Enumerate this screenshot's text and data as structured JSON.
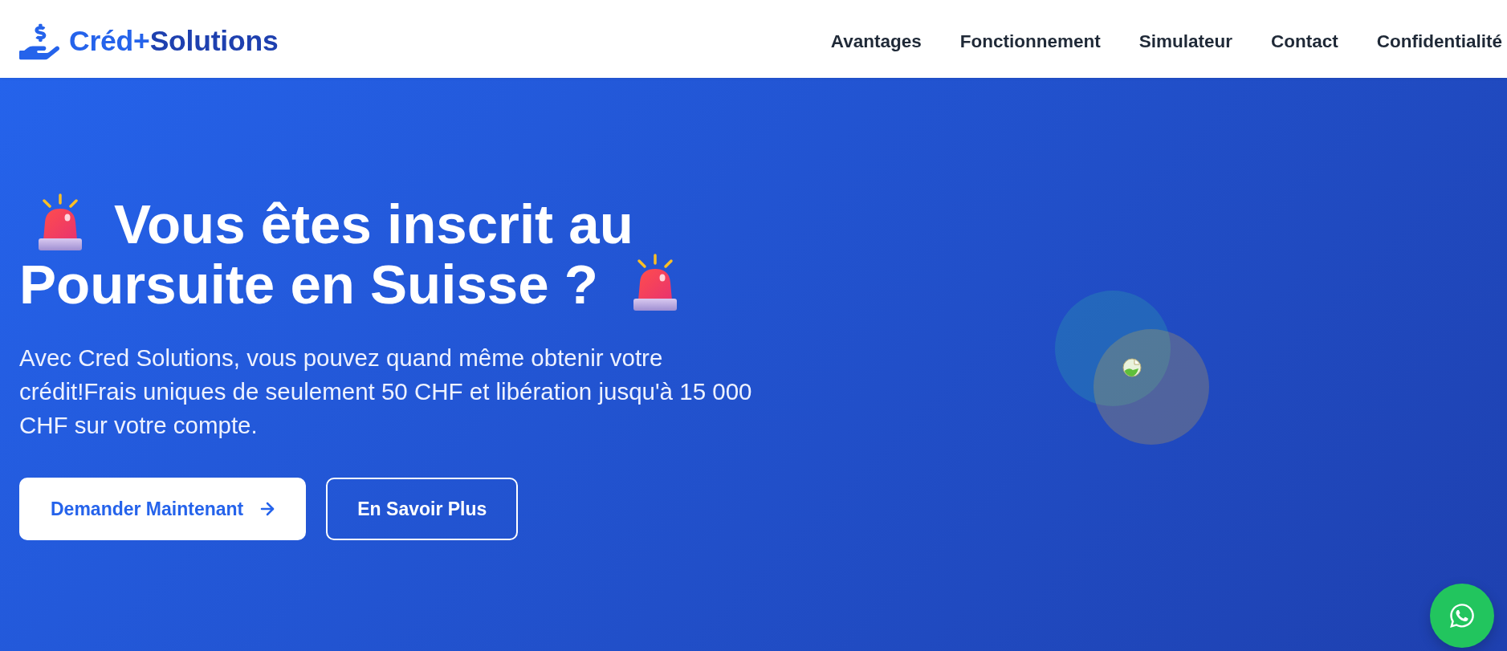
{
  "header": {
    "logo": {
      "parts": [
        "Créd+",
        "Solutions"
      ]
    },
    "nav": [
      "Avantages",
      "Fonctionnement",
      "Simulateur",
      "Contact",
      "Confidentialité"
    ]
  },
  "hero": {
    "title_lines": [
      "Vous êtes inscrit au",
      "Poursuite en Suisse ?"
    ],
    "description": "Avec Cred Solutions, vous pouvez quand même obtenir votre crédit!Frais uniques de seulement 50 CHF et libération jusqu'à 15 000 CHF sur votre compte.",
    "buttons": [
      {
        "label": "Demander Maintenant",
        "kind": "primary"
      },
      {
        "label": "En Savoir Plus",
        "kind": "outline"
      }
    ]
  }
}
